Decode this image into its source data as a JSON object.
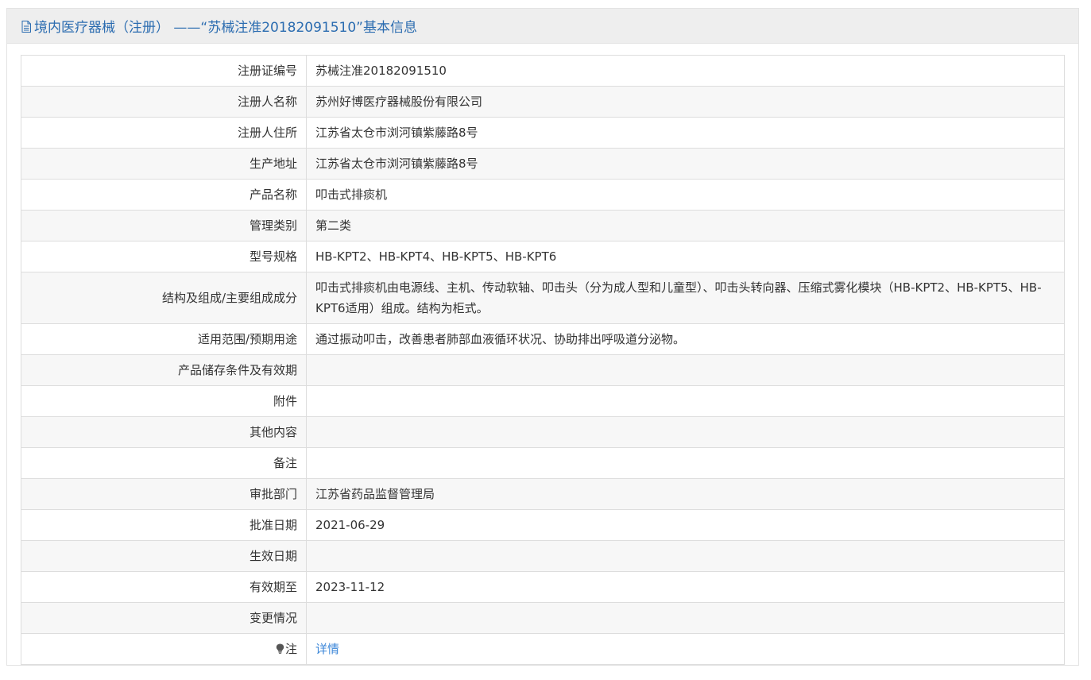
{
  "header": {
    "title": "境内医疗器械（注册） ——“苏械注准20182091510”基本信息",
    "icon": "document-icon"
  },
  "rows": [
    {
      "label": "注册证编号",
      "value": "苏械注准20182091510"
    },
    {
      "label": "注册人名称",
      "value": "苏州好博医疗器械股份有限公司"
    },
    {
      "label": "注册人住所",
      "value": "江苏省太仓市浏河镇紫藤路8号"
    },
    {
      "label": "生产地址",
      "value": "江苏省太仓市浏河镇紫藤路8号"
    },
    {
      "label": "产品名称",
      "value": "叩击式排痰机"
    },
    {
      "label": "管理类别",
      "value": "第二类"
    },
    {
      "label": "型号规格",
      "value": "HB-KPT2、HB-KPT4、HB-KPT5、HB-KPT6"
    },
    {
      "label": "结构及组成/主要组成成分",
      "value": "叩击式排痰机由电源线、主机、传动软轴、叩击头（分为成人型和儿童型）、叩击头转向器、压缩式雾化模块（HB-KPT2、HB-KPT5、HB-KPT6适用）组成。结构为柜式。"
    },
    {
      "label": "适用范围/预期用途",
      "value": "通过振动叩击，改善患者肺部血液循环状况、协助排出呼吸道分泌物。"
    },
    {
      "label": "产品储存条件及有效期",
      "value": ""
    },
    {
      "label": "附件",
      "value": ""
    },
    {
      "label": "其他内容",
      "value": ""
    },
    {
      "label": "备注",
      "value": ""
    },
    {
      "label": "审批部门",
      "value": "江苏省药品监督管理局"
    },
    {
      "label": "批准日期",
      "value": "2021-06-29"
    },
    {
      "label": "生效日期",
      "value": ""
    },
    {
      "label": "有效期至",
      "value": "2023-11-12"
    },
    {
      "label": "变更情况",
      "value": ""
    }
  ],
  "note": {
    "icon": "lightbulb-icon",
    "label": "注",
    "link_text": "详情"
  },
  "colors": {
    "header_text": "#2b6cb0",
    "link": "#3b86d8",
    "row_alt": "#f7f7f7",
    "border": "#dddddd"
  }
}
